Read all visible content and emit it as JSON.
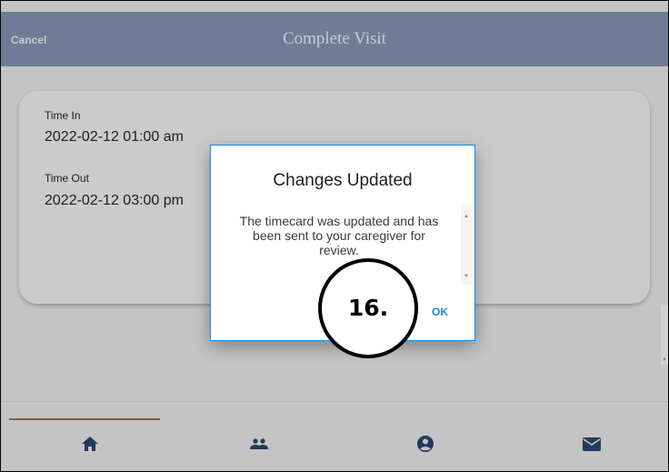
{
  "header": {
    "cancel_label": "Cancel",
    "title": "Complete Visit"
  },
  "visit": {
    "time_in_label": "Time In",
    "time_in_value": "2022-02-12 01:00 am",
    "time_out_label": "Time Out",
    "time_out_value": "2022-02-12 03:00 pm"
  },
  "dialog": {
    "title": "Changes Updated",
    "message": "The timecard was updated and has been sent to your caregiver for review.",
    "ok_label": "OK"
  },
  "callout": {
    "label": "16."
  },
  "bottom_nav": {
    "active_index": 0,
    "items": [
      {
        "icon": "home-icon"
      },
      {
        "icon": "people-icon"
      },
      {
        "icon": "account-circle-icon"
      },
      {
        "icon": "mail-icon"
      }
    ]
  },
  "colors": {
    "header_bar": "#2e5fa8",
    "accent": "#1e88e5",
    "nav_icon": "#1e3c70",
    "active_tab_line": "#e07a2a"
  }
}
